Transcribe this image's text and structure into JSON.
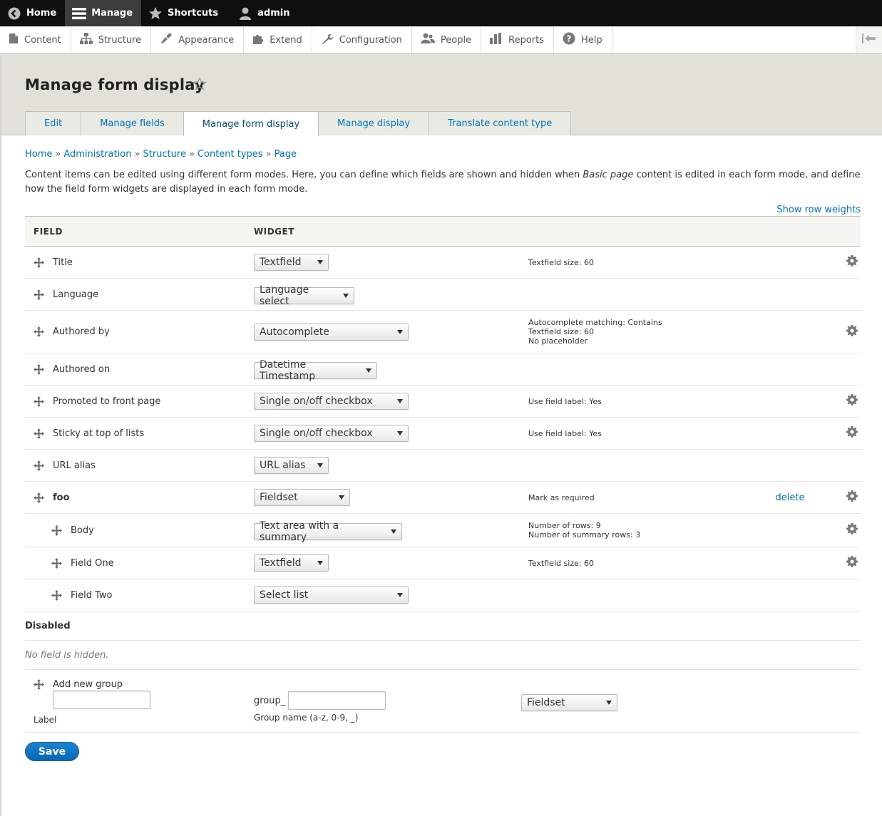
{
  "toolbar": {
    "home": "Home",
    "manage": "Manage",
    "shortcuts": "Shortcuts",
    "user": "admin"
  },
  "tray": {
    "items": [
      "Content",
      "Structure",
      "Appearance",
      "Extend",
      "Configuration",
      "People",
      "Reports",
      "Help"
    ]
  },
  "page": {
    "title": "Manage form display"
  },
  "tabs": [
    "Edit",
    "Manage fields",
    "Manage form display",
    "Manage display",
    "Translate content type"
  ],
  "breadcrumb": [
    "Home",
    "Administration",
    "Structure",
    "Content types",
    "Page"
  ],
  "description": {
    "part1": "Content items can be edited using different form modes. Here, you can define which fields are shown and hidden when ",
    "italic": "Basic page",
    "part2": " content is edited in each form mode, and define how the field form widgets are displayed in each form mode."
  },
  "show_row_weights": "Show row weights",
  "table": {
    "headers": [
      "Field",
      "Widget"
    ],
    "rows": [
      {
        "name": "Title",
        "widget": "Textfield",
        "summary": [
          "Textfield size: 60"
        ],
        "delete": "",
        "gear": true,
        "bold": false,
        "indent": false
      },
      {
        "name": "Language",
        "widget": "Language select",
        "summary": [],
        "delete": "",
        "gear": false,
        "bold": false,
        "indent": false
      },
      {
        "name": "Authored by",
        "widget": "Autocomplete",
        "summary": [
          "Autocomplete matching: Contains",
          "Textfield size: 60",
          "No placeholder"
        ],
        "delete": "",
        "gear": true,
        "bold": false,
        "indent": false
      },
      {
        "name": "Authored on",
        "widget": "Datetime Timestamp",
        "summary": [],
        "delete": "",
        "gear": false,
        "bold": false,
        "indent": false
      },
      {
        "name": "Promoted to front page",
        "widget": "Single on/off checkbox",
        "summary": [
          "Use field label: Yes"
        ],
        "delete": "",
        "gear": true,
        "bold": false,
        "indent": false
      },
      {
        "name": "Sticky at top of lists",
        "widget": "Single on/off checkbox",
        "summary": [
          "Use field label: Yes"
        ],
        "delete": "",
        "gear": true,
        "bold": false,
        "indent": false
      },
      {
        "name": "URL alias",
        "widget": "URL alias",
        "summary": [],
        "delete": "",
        "gear": false,
        "bold": false,
        "indent": false
      },
      {
        "name": "foo",
        "widget": "Fieldset",
        "summary": [
          "Mark as required"
        ],
        "delete": "delete",
        "gear": true,
        "bold": true,
        "indent": false
      },
      {
        "name": "Body",
        "widget": "Text area with a summary",
        "summary": [
          "Number of rows: 9",
          "Number of summary rows: 3"
        ],
        "delete": "",
        "gear": true,
        "bold": false,
        "indent": true
      },
      {
        "name": "Field One",
        "widget": "Textfield",
        "summary": [
          "Textfield size: 60"
        ],
        "delete": "",
        "gear": true,
        "bold": false,
        "indent": true
      },
      {
        "name": "Field Two",
        "widget": "Select list",
        "summary": [],
        "delete": "",
        "gear": false,
        "bold": false,
        "indent": true
      }
    ],
    "disabled_label": "Disabled",
    "no_hidden": "No field is hidden."
  },
  "add_group": {
    "title": "Add new group",
    "label_value": "",
    "label_caption": "Label",
    "prefix": "group_",
    "name_value": "",
    "name_caption": "Group name (a-z, 0-9, _)",
    "type_selected": "Fieldset"
  },
  "save_label": "Save",
  "colors": {
    "link": "#0074bd",
    "toolbar": "#0f0f0f",
    "header_bg": "#e1e0d9",
    "button": "#0767b5"
  }
}
